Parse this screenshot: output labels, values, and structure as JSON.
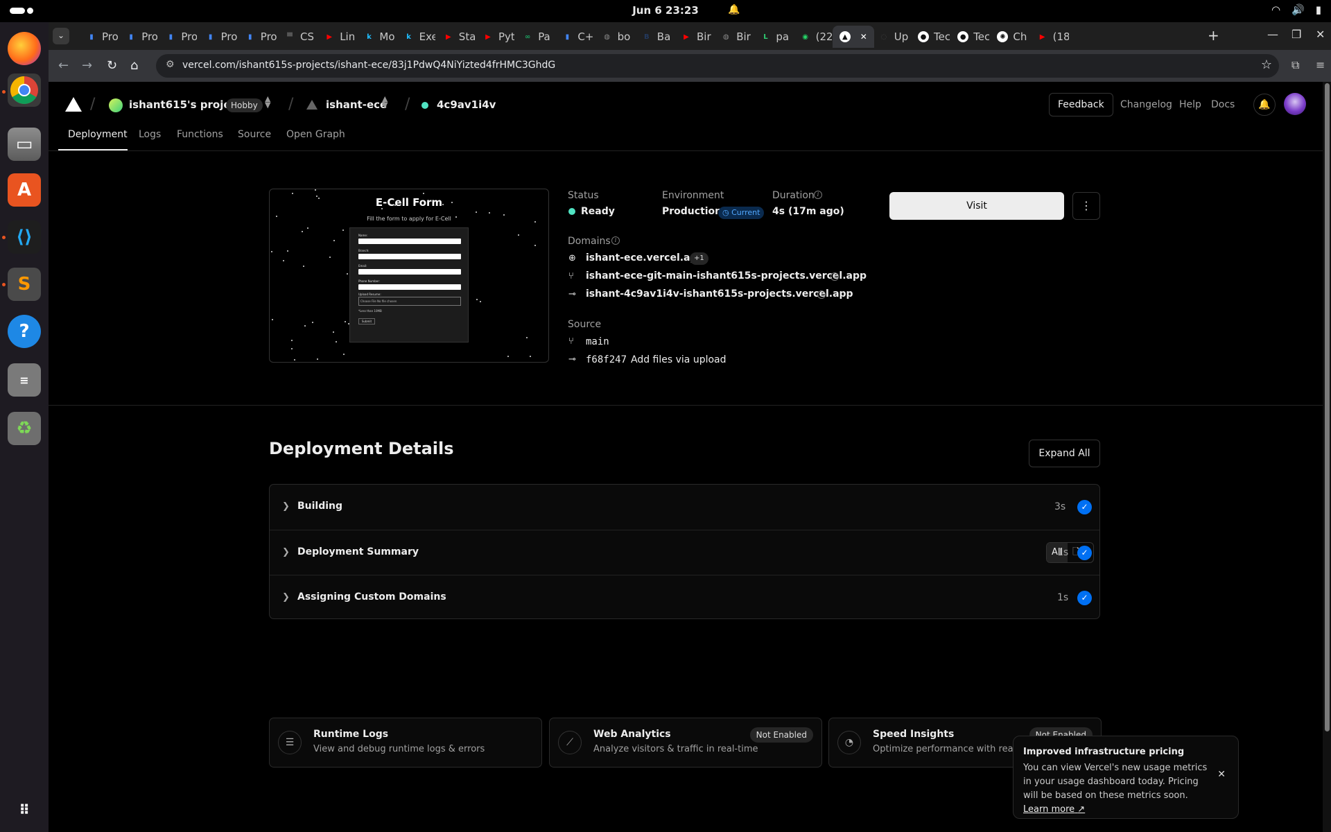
{
  "os": {
    "clock": "Jun 6  23:23"
  },
  "browser": {
    "tabs": [
      {
        "label": "Pro",
        "icon": "bar-chart-icon",
        "color": "#4285f4"
      },
      {
        "label": "Pro",
        "icon": "bar-chart-icon",
        "color": "#4285f4"
      },
      {
        "label": "Pro",
        "icon": "bar-chart-icon",
        "color": "#4285f4"
      },
      {
        "label": "Pro",
        "icon": "bar-chart-icon",
        "color": "#4285f4"
      },
      {
        "label": "Pro",
        "icon": "bar-chart-icon",
        "color": "#4285f4"
      },
      {
        "label": "CS",
        "icon": "cs-icon",
        "color": "#555555"
      },
      {
        "label": "Lin",
        "icon": "youtube-icon",
        "color": "#ff0000"
      },
      {
        "label": "Mo",
        "icon": "k-icon",
        "color": "#20beff"
      },
      {
        "label": "Exe",
        "icon": "k-icon",
        "color": "#20beff"
      },
      {
        "label": "Sta",
        "icon": "youtube-icon",
        "color": "#ff0000"
      },
      {
        "label": "Pyt",
        "icon": "youtube-icon",
        "color": "#ff0000"
      },
      {
        "label": "Pa",
        "icon": "link-icon",
        "color": "#1fa463"
      },
      {
        "label": "C+",
        "icon": "bar-chart-icon",
        "color": "#4285f4"
      },
      {
        "label": "bo",
        "icon": "globe-icon",
        "color": "#888888"
      },
      {
        "label": "Ba",
        "icon": "b-icon",
        "color": "#23395d"
      },
      {
        "label": "Bir",
        "icon": "youtube-icon",
        "color": "#ff0000"
      },
      {
        "label": "Bir",
        "icon": "globe-icon",
        "color": "#888888"
      },
      {
        "label": "pa",
        "icon": "leetcode-icon",
        "color": "#2ecc71"
      },
      {
        "label": "(22",
        "icon": "whatsapp-icon",
        "color": "#25d366"
      },
      {
        "label": "",
        "icon": "vercel-icon",
        "color": "#000000",
        "active": true
      },
      {
        "label": "Up",
        "icon": "loading-icon",
        "color": "#444444"
      },
      {
        "label": "Tec",
        "icon": "github-icon",
        "color": "#ffffff"
      },
      {
        "label": "Tec",
        "icon": "github-icon",
        "color": "#ffffff"
      },
      {
        "label": "Ch",
        "icon": "openai-icon",
        "color": "#ffffff"
      },
      {
        "label": "(18",
        "icon": "youtube-icon",
        "color": "#ff0000"
      }
    ],
    "url": "vercel.com/ishant615s-projects/ishant-ece/83j1PdwQ4NiYizted4frHMC3GhdG"
  },
  "header": {
    "team": "ishant615's projects",
    "plan": "Hobby",
    "project": "ishant-ece",
    "deployment_id": "4c9av1i4v",
    "feedback": "Feedback",
    "changelog": "Changelog",
    "help": "Help",
    "docs": "Docs"
  },
  "subnav": [
    "Deployment",
    "Logs",
    "Functions",
    "Source",
    "Open Graph"
  ],
  "preview": {
    "title": "E-Cell Form",
    "subtitle": "Fill the form to apply for E-Cell",
    "labels": [
      "Name:",
      "Branch:",
      "Email:",
      "Phone Number:",
      "Upload Resume:"
    ],
    "file_button": "Choose File",
    "file_text": "No file chosen",
    "note": "*Less than 10MB",
    "submit": "Submit"
  },
  "deployment": {
    "status_label": "Status",
    "status": "Ready",
    "environment_label": "Environment",
    "environment": "Production",
    "current_badge": "Current",
    "duration_label": "Duration",
    "duration": "4s (17m ago)",
    "domains_label": "Domains",
    "domains": [
      "ishant-ece.vercel.app",
      "ishant-ece-git-main-ishant615s-projects.vercel.app",
      "ishant-4c9av1i4v-ishant615s-projects.vercel.app"
    ],
    "extra_domains": "+1",
    "source_label": "Source",
    "branch": "main",
    "commit": "f68f247",
    "commit_message": "Add files via upload",
    "visit": "Visit"
  },
  "details": {
    "title": "Deployment Details",
    "expand_all": "Expand All",
    "steps": [
      {
        "title": "Building",
        "time": "3s"
      },
      {
        "title": "Deployment Summary",
        "time": "1s",
        "filter": "All",
        "files": "8"
      },
      {
        "title": "Assigning Custom Domains",
        "time": "1s"
      }
    ]
  },
  "cards": [
    {
      "title": "Runtime Logs",
      "desc": "View and debug runtime logs & errors",
      "badge": ""
    },
    {
      "title": "Web Analytics",
      "desc": "Analyze visitors & traffic in real-time",
      "badge": "Not Enabled"
    },
    {
      "title": "Speed Insights",
      "desc": "Optimize performance with real user metrics",
      "badge": "Not Enabled"
    }
  ],
  "toast": {
    "title": "Improved infrastructure pricing",
    "body": "You can view Vercel's new usage metrics in your usage dashboard today. Pricing will be based on these metrics soon.",
    "link": "Learn more"
  },
  "colors": {
    "status_ready": "#50e3c2",
    "check_blue": "#0070f3",
    "current_badge": "#52a8ff"
  }
}
